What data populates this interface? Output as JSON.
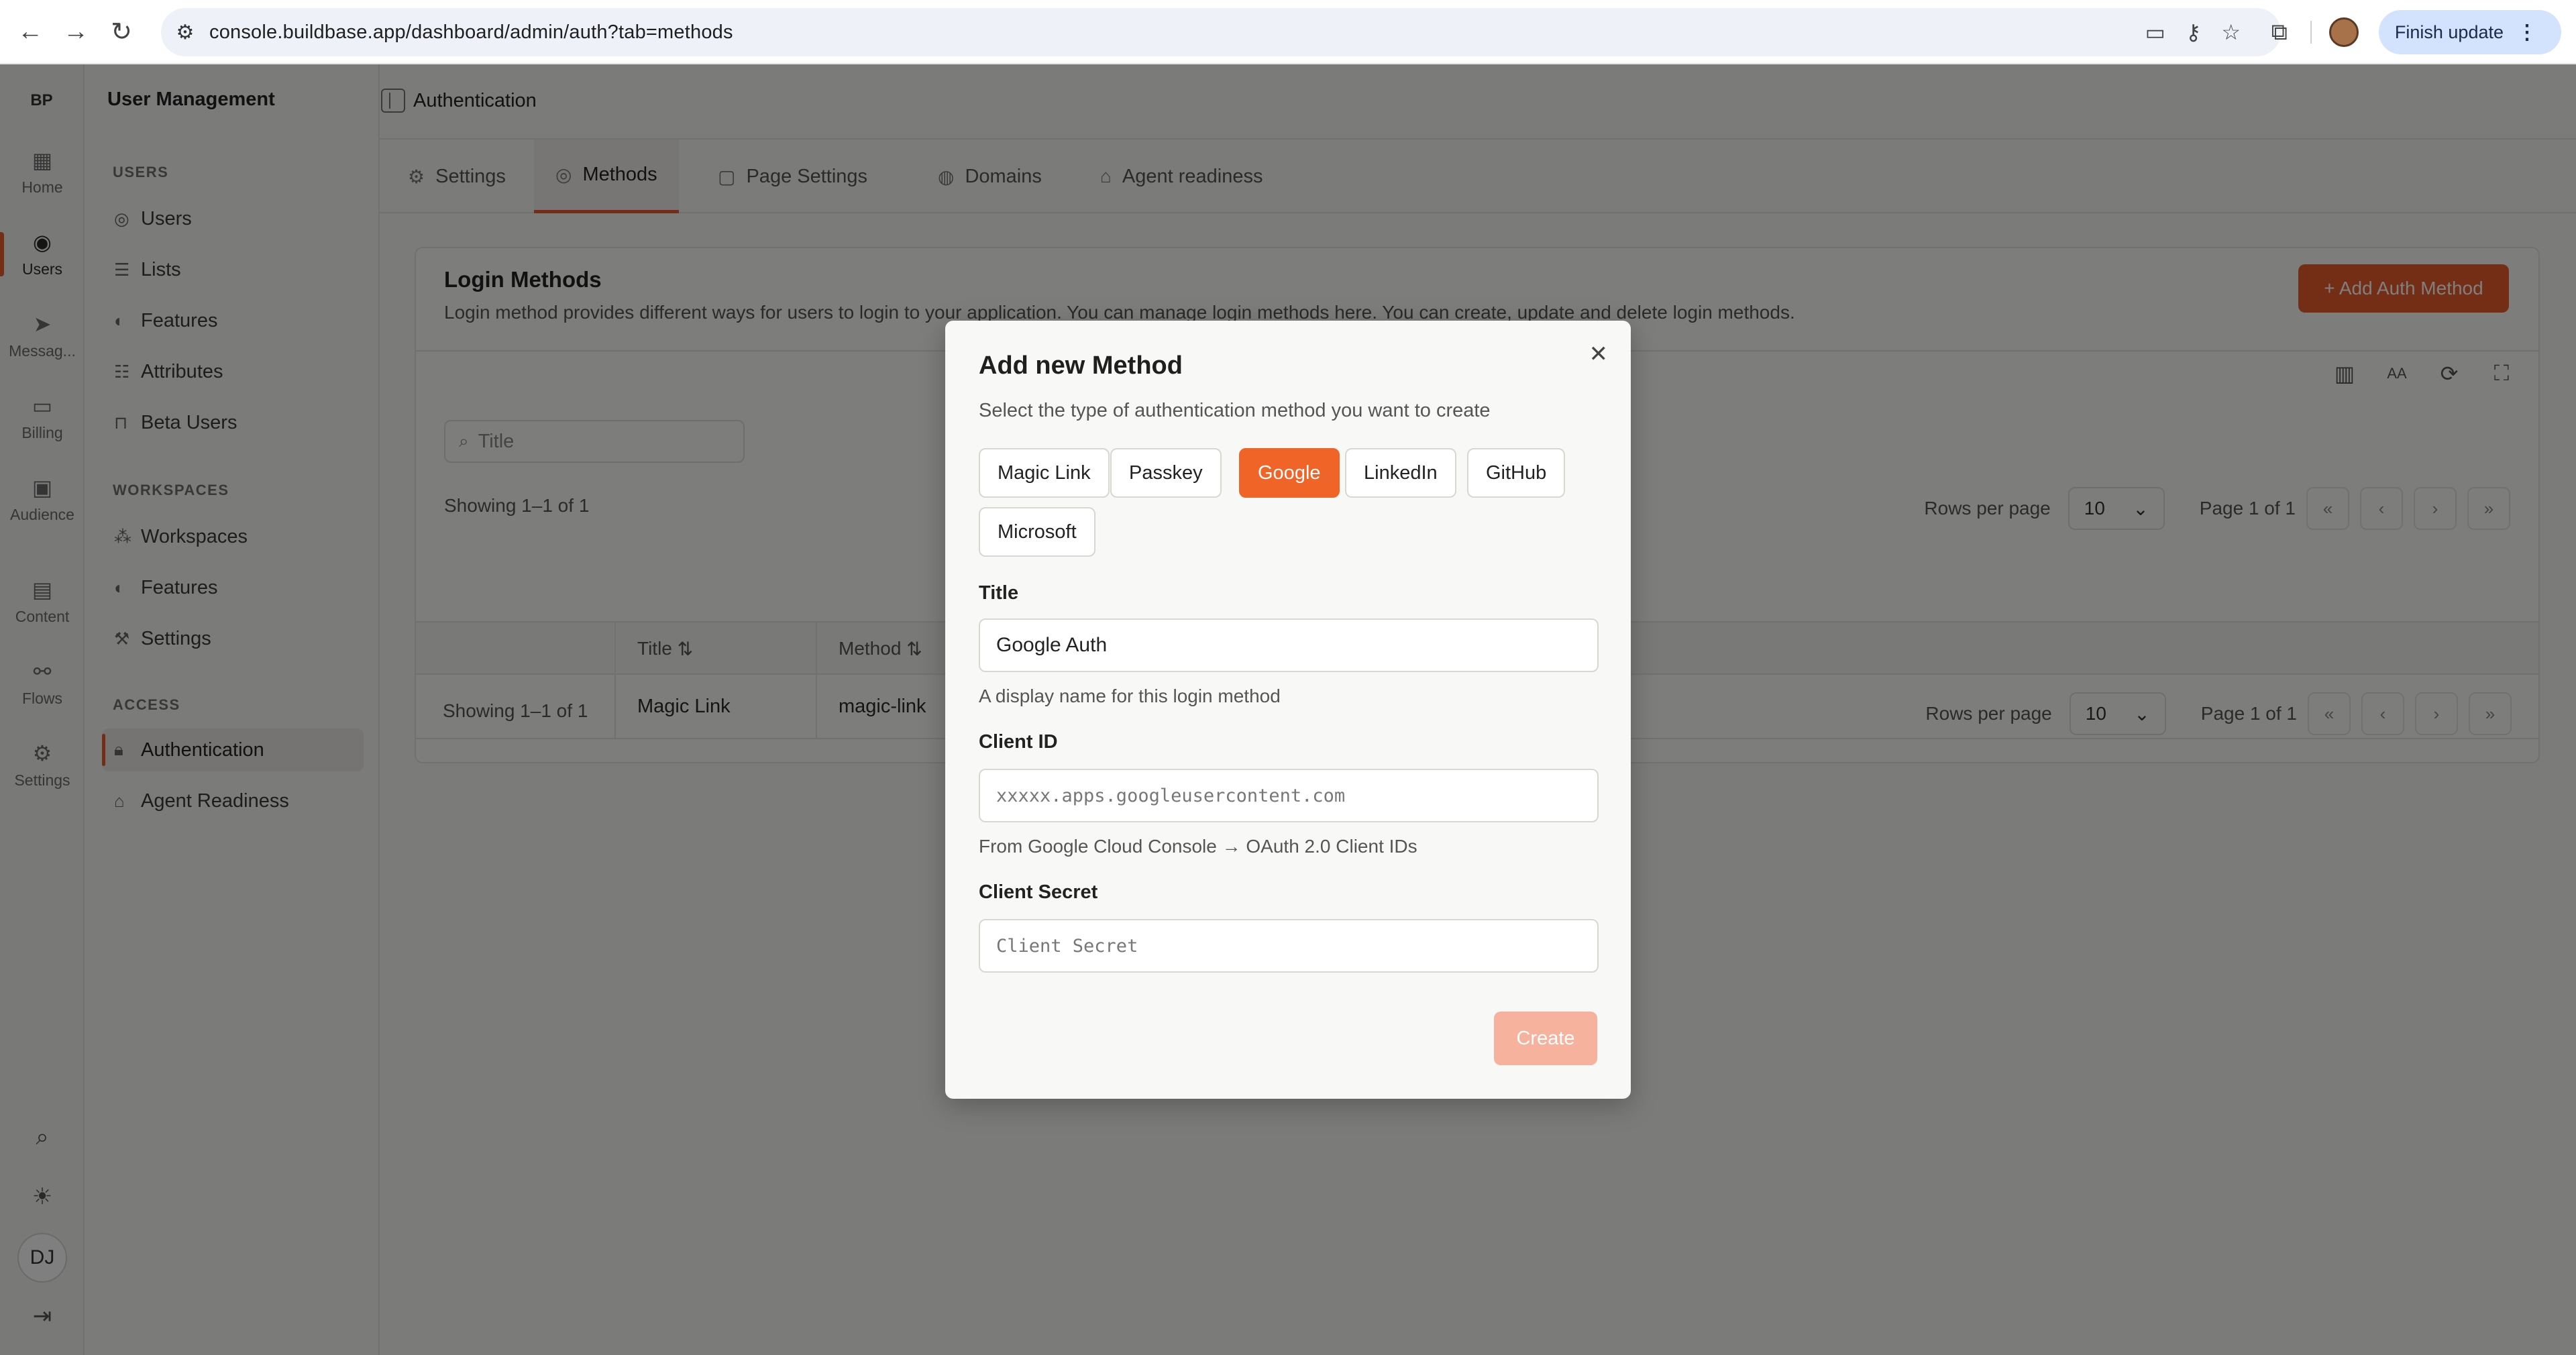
{
  "browser": {
    "url": "console.buildbase.app/dashboard/admin/auth?tab=methods",
    "finish_update_label": "Finish update"
  },
  "rail": {
    "logo": "BP",
    "items": [
      {
        "label": "Home",
        "icon": "grid-icon"
      },
      {
        "label": "Users",
        "icon": "user-circle-icon"
      },
      {
        "label": "Messag...",
        "icon": "send-icon"
      },
      {
        "label": "Billing",
        "icon": "credit-card-icon"
      },
      {
        "label": "Audience",
        "icon": "audience-icon"
      },
      {
        "label": "Content",
        "icon": "document-icon"
      },
      {
        "label": "Flows",
        "icon": "flow-icon"
      },
      {
        "label": "Settings",
        "icon": "gear-icon"
      }
    ],
    "avatar_initials": "DJ"
  },
  "sidebar": {
    "title": "User Management",
    "sections": [
      {
        "label": "USERS",
        "items": [
          "Users",
          "Lists",
          "Features",
          "Attributes",
          "Beta Users"
        ]
      },
      {
        "label": "WORKSPACES",
        "items": [
          "Workspaces",
          "Features",
          "Settings"
        ]
      },
      {
        "label": "ACCESS",
        "items": [
          "Authentication",
          "Agent Readiness"
        ]
      }
    ]
  },
  "header": {
    "title": "Authentication"
  },
  "tabs": [
    "Settings",
    "Methods",
    "Page Settings",
    "Domains",
    "Agent readiness"
  ],
  "card": {
    "title": "Login Methods",
    "description": "Login method provides different ways for users to login to your application. You can manage login methods here. You can create, update and delete login methods.",
    "add_button": "+ Add Auth Method",
    "search_placeholder": "Title",
    "showing": "Showing 1–1 of 1",
    "rows_per_page_label": "Rows per page",
    "rows_per_page_value": "10",
    "page_label": "Page 1 of 1",
    "columns": [
      "Title",
      "Method"
    ],
    "rows": [
      {
        "title": "Magic Link",
        "method": "magic-link"
      }
    ]
  },
  "modal": {
    "title": "Add new Method",
    "subtitle": "Select the type of authentication method you want to create",
    "methods": [
      "Magic Link",
      "Passkey",
      "Google",
      "LinkedIn",
      "GitHub",
      "Microsoft"
    ],
    "selected_method": "Google",
    "title_label": "Title",
    "title_value": "Google Auth",
    "title_help": "A display name for this login method",
    "client_id_label": "Client ID",
    "client_id_placeholder": "xxxxx.apps.googleusercontent.com",
    "client_id_help": "From Google Cloud Console → OAuth 2.0 Client IDs",
    "client_secret_label": "Client Secret",
    "client_secret_placeholder": "Client Secret",
    "create_label": "Create"
  },
  "colors": {
    "accent": "#e85d2a",
    "accent_disabled": "#f6b29d"
  }
}
